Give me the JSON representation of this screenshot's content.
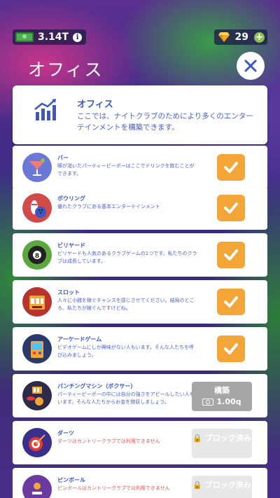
{
  "topbar": {
    "cash": "3.14T",
    "gems": "29"
  },
  "screen": {
    "title": "オフィス"
  },
  "header": {
    "title": "オフィス",
    "description": "ここでは、ナイトクラブのためにより多くのエンターテインメントを構築できます。"
  },
  "items": [
    {
      "name": "バー",
      "desc": "喉が渇いたパーティーピーポーはここでドリンクを飲むことができます。",
      "state": "built",
      "icon": "cocktail-icon"
    },
    {
      "name": "ボウリング",
      "desc": "優れたクラブにある基本エンターテインメント",
      "state": "built",
      "icon": "bowling-icon"
    },
    {
      "name": "ビリヤード",
      "desc": "ビリヤードも人気のあるクラブゲームの1つです。私たちのクラブは成長しています。",
      "state": "built",
      "icon": "billiard-ball-icon"
    },
    {
      "name": "スロット",
      "desc": "人々に小銭を稼ぐチャンスを感じさせてください。結局のところ、私たちが稼ぐんですけどね。",
      "state": "built",
      "icon": "slot-machine-icon"
    },
    {
      "name": "アーケードゲーム",
      "desc": "ビデオゲームにしか興味がない人もいます。そんな人たちを呼び込みましょう。",
      "state": "built",
      "icon": "arcade-icon"
    },
    {
      "name": "パンチングマシン（ボクサー）",
      "desc": "パーティーピーポーの中には自分の強さをアピールしたい人もいます。そんな人たちからお金を徴収しましょう。",
      "state": "build",
      "build_label": "構築",
      "cost": "1.00q",
      "icon": "punching-machine-icon"
    },
    {
      "name": "ダーツ",
      "desc": "ダーツはカントリークラブでは利用できません",
      "state": "locked",
      "locked_label": "ブロック済み",
      "icon": "darts-icon"
    },
    {
      "name": "ピンボール",
      "desc": "ピンボールはカントリークラブでは利用できません",
      "state": "locked",
      "locked_label": "ブロック済み",
      "icon": "pinball-icon"
    }
  ],
  "colors": {
    "accent": "#3a57c4",
    "check": "#f3a637",
    "build": "#a6a6a6",
    "locked": "#e7e7e7",
    "warning": "#e05555"
  }
}
